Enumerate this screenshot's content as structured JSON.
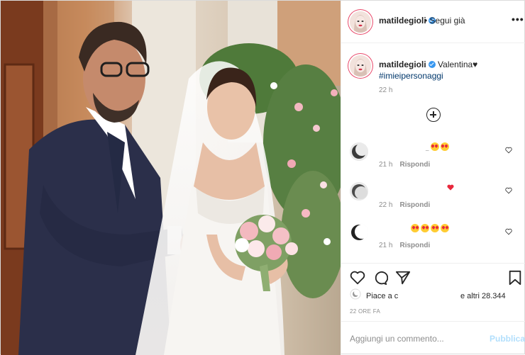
{
  "post": {
    "username": "matildegioli",
    "follow_state": "Segui già",
    "more": "•••",
    "caption_text": "Valentina♥",
    "hashtag": "#imieipersonaggi",
    "caption_time": "22 h"
  },
  "comments": [
    {
      "time": "21 h",
      "reply": "Rispondi",
      "emojis": 2,
      "heart": false
    },
    {
      "time": "22 h",
      "reply": "Rispondi",
      "emojis": 0,
      "heart": true
    },
    {
      "time": "21 h",
      "reply": "Rispondi",
      "emojis": 4,
      "heart": false
    }
  ],
  "likes": {
    "left": "Piace a c",
    "right": "e altri 28.344"
  },
  "age": "22 ORE FA",
  "comment_box": {
    "placeholder": "Aggiungi un commento...",
    "post_label": "Pubblica"
  },
  "colors": {
    "accent": "#3897f0",
    "post_disabled": "#b2dffc",
    "story_ring": "#e94a6b"
  },
  "icons": [
    "heart-icon",
    "comment-icon",
    "share-icon",
    "bookmark-icon",
    "add-comments-icon",
    "more-icon",
    "verified-icon"
  ]
}
